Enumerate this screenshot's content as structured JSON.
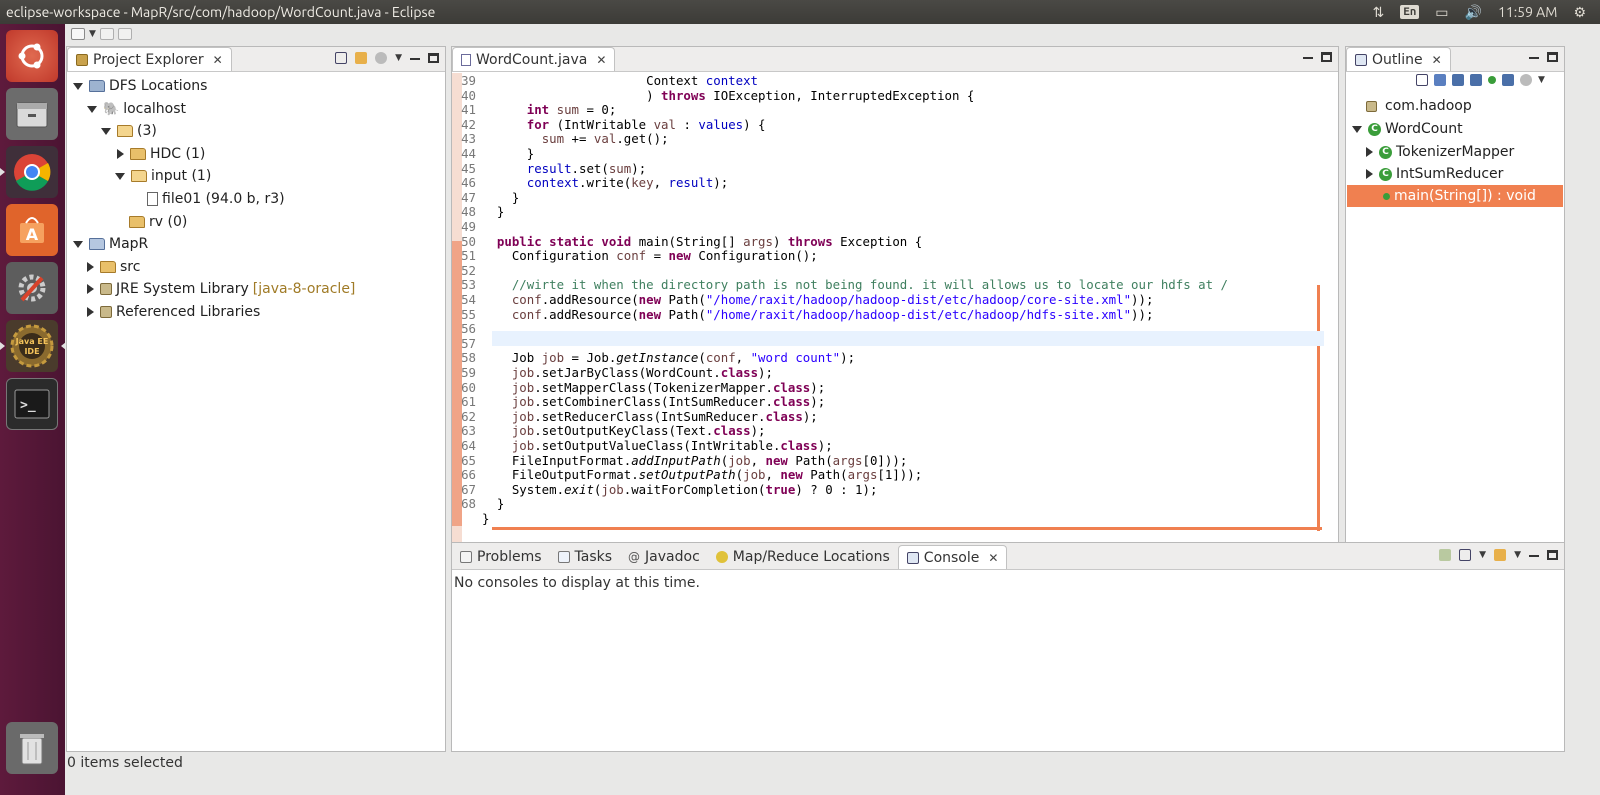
{
  "window": {
    "title": "eclipse-workspace - MapR/src/com/hadoop/WordCount.java - Eclipse"
  },
  "systray": {
    "lang": "En",
    "time": "11:59 AM"
  },
  "colors": {
    "launcher": "#5e1a3c",
    "accent": "#f08050",
    "keyword": "#7f0055",
    "string": "#2a00ff",
    "comment": "#3f7f5f"
  },
  "launcher": {
    "items": [
      "ubuntu-dash-icon",
      "files-icon",
      "chrome-icon",
      "software-center-icon",
      "system-settings-icon",
      "eclipse-javaee-icon",
      "terminal-icon",
      "trash-icon"
    ],
    "javaee_label": "Java EE IDE"
  },
  "project_explorer": {
    "tab_label": "Project Explorer",
    "tree": [
      {
        "label": "DFS Locations",
        "suffix": ""
      },
      {
        "label": "localhost",
        "suffix": ""
      },
      {
        "label": "(3)",
        "suffix": ""
      },
      {
        "label": "HDC (1)",
        "suffix": ""
      },
      {
        "label": "input (1)",
        "suffix": ""
      },
      {
        "label": "file01 (94.0 b, r3)",
        "suffix": ""
      },
      {
        "label": "rv (0)",
        "suffix": ""
      },
      {
        "label": "MapR",
        "suffix": ""
      },
      {
        "label": "src",
        "suffix": ""
      },
      {
        "label": "JRE System Library",
        "suffix": "[java-8-oracle]"
      },
      {
        "label": "Referenced Libraries",
        "suffix": ""
      }
    ]
  },
  "editor": {
    "tab_label": "WordCount.java",
    "lines": [
      {
        "n": "39",
        "t": "                      Context context"
      },
      {
        "n": "40",
        "t": "                      ) throws IOException, InterruptedException {"
      },
      {
        "n": "41",
        "t": "      int sum = 0;"
      },
      {
        "n": "42",
        "t": "      for (IntWritable val : values) {"
      },
      {
        "n": "43",
        "t": "        sum += val.get();"
      },
      {
        "n": "44",
        "t": "      }"
      },
      {
        "n": "45",
        "t": "      result.set(sum);"
      },
      {
        "n": "46",
        "t": "      context.write(key, result);"
      },
      {
        "n": "47",
        "t": "    }"
      },
      {
        "n": "48",
        "t": "  }"
      },
      {
        "n": "49",
        "t": ""
      },
      {
        "n": "50",
        "t": "  public static void main(String[] args) throws Exception {"
      },
      {
        "n": "51",
        "t": "    Configuration conf = new Configuration();"
      },
      {
        "n": "52",
        "t": ""
      },
      {
        "n": "53",
        "t": "    //wirte it when the directory path is not being found. it will allows us to locate our hdfs at /"
      },
      {
        "n": "54",
        "t": "    conf.addResource(new Path(\"/home/raxit/hadoop/hadoop-dist/etc/hadoop/core-site.xml\"));"
      },
      {
        "n": "55",
        "t": "    conf.addResource(new Path(\"/home/raxit/hadoop/hadoop-dist/etc/hadoop/hdfs-site.xml\"));"
      },
      {
        "n": "56",
        "t": ""
      },
      {
        "n": "57",
        "t": ""
      },
      {
        "n": "58",
        "t": "    Job job = Job.getInstance(conf, \"word count\");"
      },
      {
        "n": "59",
        "t": "    job.setJarByClass(WordCount.class);"
      },
      {
        "n": "60",
        "t": "    job.setMapperClass(TokenizerMapper.class);"
      },
      {
        "n": "61",
        "t": "    job.setCombinerClass(IntSumReducer.class);"
      },
      {
        "n": "62",
        "t": "    job.setReducerClass(IntSumReducer.class);"
      },
      {
        "n": "63",
        "t": "    job.setOutputKeyClass(Text.class);"
      },
      {
        "n": "64",
        "t": "    job.setOutputValueClass(IntWritable.class);"
      },
      {
        "n": "65",
        "t": "    FileInputFormat.addInputPath(job, new Path(args[0]));"
      },
      {
        "n": "66",
        "t": "    FileOutputFormat.setOutputPath(job, new Path(args[1]));"
      },
      {
        "n": "67",
        "t": "    System.exit(job.waitForCompletion(true) ? 0 : 1);"
      },
      {
        "n": "68",
        "t": "  }"
      },
      {
        "n": "",
        "t": "}"
      }
    ]
  },
  "outline": {
    "tab_label": "Outline",
    "items": [
      {
        "label": "com.hadoop"
      },
      {
        "label": "WordCount"
      },
      {
        "label": "TokenizerMapper"
      },
      {
        "label": "IntSumReducer"
      },
      {
        "label": "main(String[]) : void"
      }
    ]
  },
  "bottom": {
    "tabs": [
      {
        "label": "Problems"
      },
      {
        "label": "Tasks"
      },
      {
        "label": "Javadoc"
      },
      {
        "label": "Map/Reduce Locations"
      },
      {
        "label": "Console"
      }
    ],
    "console_message": "No consoles to display at this time."
  },
  "status": {
    "text": "0 items selected"
  }
}
